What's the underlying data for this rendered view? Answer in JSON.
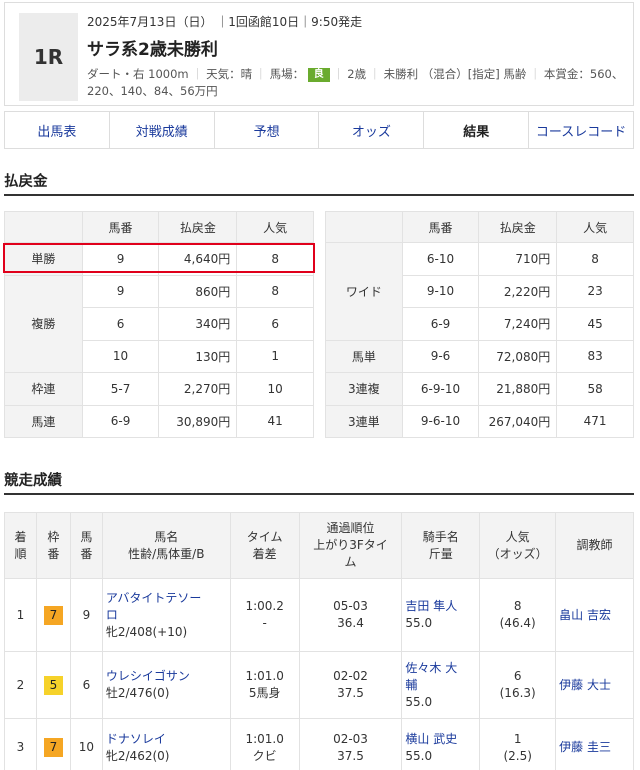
{
  "race": {
    "number": "1R",
    "date_line": "2025年7月13日（日） ｜1回函館10日｜9:50発走",
    "name": "サラ系2歳未勝利",
    "course": "ダート・右 1000m",
    "weather": "天気：晴",
    "ground_label": "馬場：",
    "ground_value": "良",
    "age": "2歳",
    "condition": "未勝利 （混合）[指定] 馬齢",
    "prize": "本賞金：560、220、140、84、56万円",
    "ground_color": "#6aab2e"
  },
  "tabs": [
    {
      "label": "出馬表"
    },
    {
      "label": "対戦成績"
    },
    {
      "label": "予想"
    },
    {
      "label": "オッズ"
    },
    {
      "label": "結果"
    },
    {
      "label": "コースレコード"
    }
  ],
  "payout": {
    "title": "払戻金",
    "headers": {
      "num": "馬番",
      "amount": "払戻金",
      "pop": "人気"
    },
    "left": {
      "tansho": {
        "label": "単勝",
        "num": "9",
        "amount": "4,640円",
        "pop": "8"
      },
      "fukusho": {
        "label": "複勝",
        "rows": [
          {
            "num": "9",
            "amount": "860円",
            "pop": "8"
          },
          {
            "num": "6",
            "amount": "340円",
            "pop": "6"
          },
          {
            "num": "10",
            "amount": "130円",
            "pop": "1"
          }
        ]
      },
      "wakuren": {
        "label": "枠連",
        "num": "5-7",
        "amount": "2,270円",
        "pop": "10"
      },
      "umaren": {
        "label": "馬連",
        "num": "6-9",
        "amount": "30,890円",
        "pop": "41"
      }
    },
    "right": {
      "wide": {
        "label": "ワイド",
        "rows": [
          {
            "num": "6-10",
            "amount": "710円",
            "pop": "8"
          },
          {
            "num": "9-10",
            "amount": "2,220円",
            "pop": "23"
          },
          {
            "num": "6-9",
            "amount": "7,240円",
            "pop": "45"
          }
        ]
      },
      "umatan": {
        "label": "馬単",
        "num": "9-6",
        "amount": "72,080円",
        "pop": "83"
      },
      "sanrenpuku": {
        "label": "3連複",
        "num": "6-9-10",
        "amount": "21,880円",
        "pop": "58"
      },
      "sanrentan": {
        "label": "3連単",
        "num": "9-6-10",
        "amount": "267,040円",
        "pop": "471"
      }
    },
    "highlight_color": "#e0001b"
  },
  "results": {
    "title": "競走成績",
    "headers": {
      "rank": [
        "着",
        "順"
      ],
      "frame": [
        "枠",
        "番"
      ],
      "horse_no": [
        "馬",
        "番"
      ],
      "horse": [
        "馬名",
        "性齢/馬体重/B"
      ],
      "time": [
        "タイム",
        "着差"
      ],
      "passing": [
        "通過順位",
        "上がり3Fタイ",
        "ム"
      ],
      "jockey": [
        "騎手名",
        "斤量"
      ],
      "odds": [
        "人気",
        "（オッズ）"
      ],
      "trainer": "調教師"
    },
    "rows": [
      {
        "rank": "1",
        "frame": "7",
        "frame_color": "#f5a623",
        "horse_no": "9",
        "horse_l1": "アバタイトテソー",
        "horse_l2": "ロ",
        "horse_info": "牝2/408(+10)",
        "time": "1:00.2",
        "margin": "-",
        "passing": "05-03",
        "last3f": "36.4",
        "jockey_l1": "吉田 隼人",
        "jockey_l2": "",
        "weight": "55.0",
        "pop": "8",
        "odds": "(46.4)",
        "trainer": "畠山 吉宏"
      },
      {
        "rank": "2",
        "frame": "5",
        "frame_color": "#f6d22a",
        "horse_no": "6",
        "horse_l1": "ウレシイゴサン",
        "horse_l2": "",
        "horse_info": "牡2/476(0)",
        "time": "1:01.0",
        "margin": "5馬身",
        "passing": "02-02",
        "last3f": "37.5",
        "jockey_l1": "佐々木 大",
        "jockey_l2": "輔",
        "weight": "55.0",
        "pop": "6",
        "odds": "(16.3)",
        "trainer": "伊藤 大士"
      },
      {
        "rank": "3",
        "frame": "7",
        "frame_color": "#f5a623",
        "horse_no": "10",
        "horse_l1": "ドナソレイ",
        "horse_l2": "",
        "horse_info": "牝2/462(0)",
        "time": "1:01.0",
        "margin": "クビ",
        "passing": "02-03",
        "last3f": "37.5",
        "jockey_l1": "横山 武史",
        "jockey_l2": "",
        "weight": "55.0",
        "pop": "1",
        "odds": "(2.5)",
        "trainer": "伊藤 圭三"
      }
    ]
  }
}
